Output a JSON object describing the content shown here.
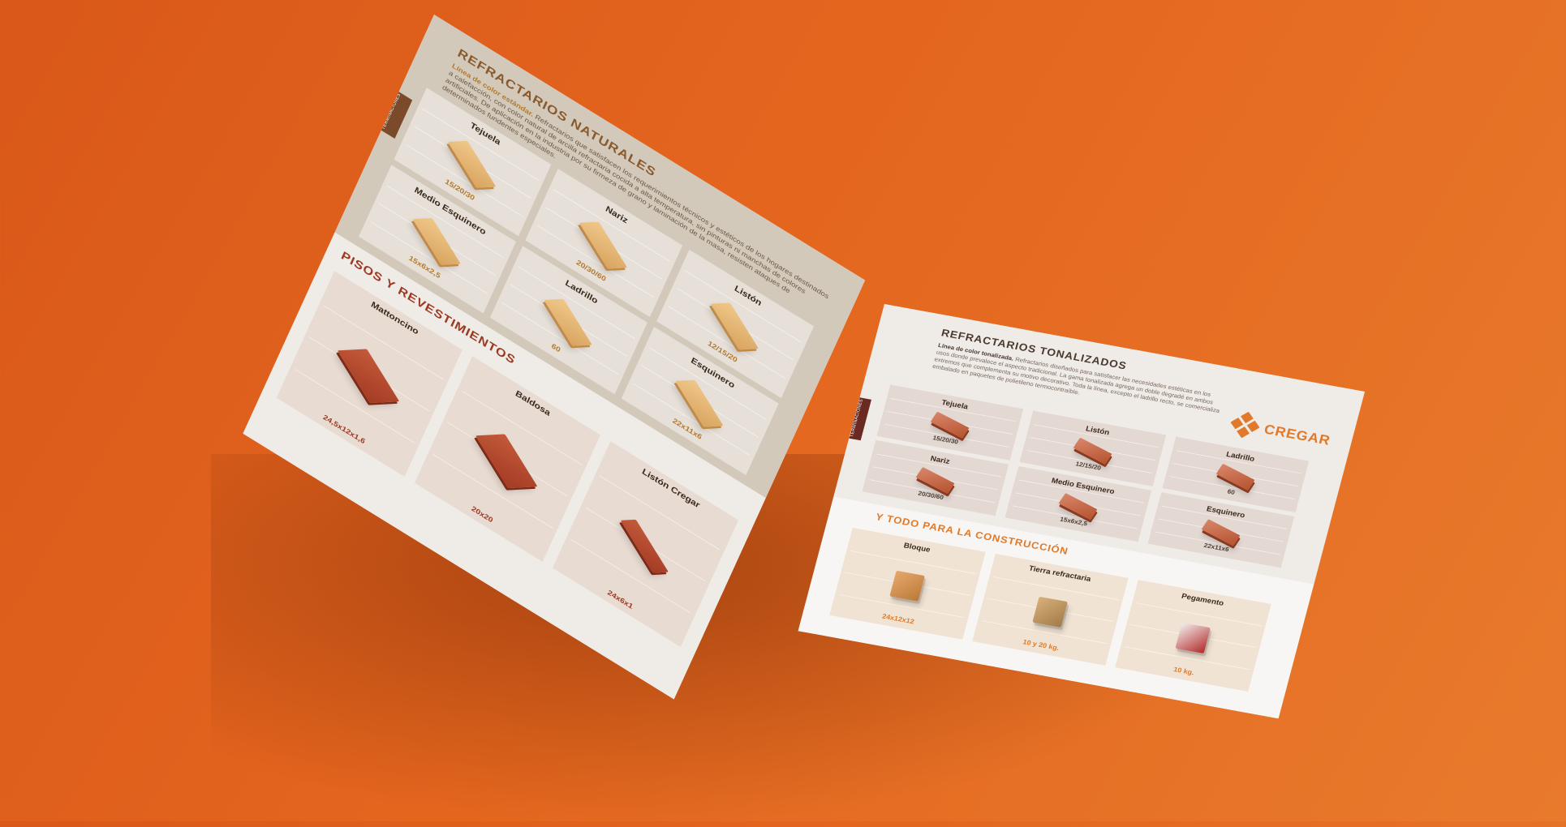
{
  "left_page": {
    "naturales": {
      "title": "REFRACTARIOS NATURALES",
      "desc_lead": "Línea de color estándar.",
      "desc_body": "Refractarios que satisfacen los requerimientos técnicos y estéticos de los hogares destinados a calefacción, con color natural de arcilla refractaria cocida a alta temperatura, sin pinturas ni manchas de colores artificiales. De aplicación en la industria por su firmeza de grano y laminación de la masa, resisten ataques de determinados fundentes especiales.",
      "tab": "TERMINACIONES",
      "items": [
        {
          "name": "Tejuela",
          "size": "15/20/30"
        },
        {
          "name": "Nariz",
          "size": "20/30/60"
        },
        {
          "name": "Listón",
          "size": "12/15/20"
        },
        {
          "name": "Medio Esquinero",
          "size": "15x6x2,5"
        },
        {
          "name": "Ladrillo",
          "size": "60"
        },
        {
          "name": "Esquinero",
          "size": "22x11x6"
        }
      ]
    },
    "pisos": {
      "title": "PISOS Y REVESTIMIENTOS",
      "items": [
        {
          "name": "Mattoncino",
          "size": "24,5x12x1,6"
        },
        {
          "name": "Baldosa",
          "size": "20x20"
        },
        {
          "name": "Listón Cregar",
          "size": "24x6x1"
        }
      ]
    }
  },
  "right_page": {
    "tonalizados": {
      "title": "REFRACTARIOS TONALIZADOS",
      "desc_lead": "Línea de color tonalizada.",
      "desc_body": "Refractarios diseñados para satisfacer las necesidades estéticas en los usos donde prevalece el aspecto tradicional. La gama tonalizada agrega un doble degradé en ambos extremos que complementa su motivo decorativo. Toda la línea, excepto el ladrillo recto, se comercializa embalado en paquetes de polietileno termocontraíble.",
      "tab": "TERMINACIONES",
      "items": [
        {
          "name": "Tejuela",
          "size": "15/20/30"
        },
        {
          "name": "Listón",
          "size": "12/15/20"
        },
        {
          "name": "Ladrillo",
          "size": "60"
        },
        {
          "name": "Nariz",
          "size": "20/30/60"
        },
        {
          "name": "Medio Esquinero",
          "size": "15x6x2,5"
        },
        {
          "name": "Esquinero",
          "size": "22x11x6"
        }
      ]
    },
    "construccion": {
      "title": "Y TODO PARA LA CONSTRUCCIÓN",
      "items": [
        {
          "name": "Bloque",
          "size": "24x12x12"
        },
        {
          "name": "Tierra refractaria",
          "size": "10 y 20 kg."
        },
        {
          "name": "Pegamento",
          "size": "10 kg."
        }
      ]
    },
    "logo_text": "CREGAR"
  },
  "colors": {
    "background": "#e26a22",
    "brand_orange": "#e07a2a",
    "title_brown": "#8a5a2c",
    "pisos_red": "#9c3a22",
    "tonal_dark": "#4a3a30"
  }
}
